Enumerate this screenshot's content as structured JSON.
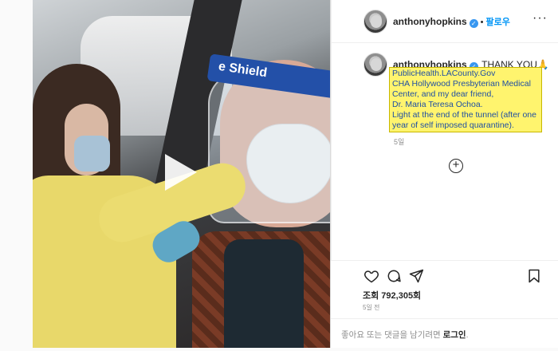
{
  "post": {
    "media": {
      "shield_text": "e Shield",
      "play_icon": "play-icon"
    },
    "header": {
      "username": "anthonyhopkins",
      "verified_icon": "verified-badge-icon",
      "separator": "•",
      "follow_label": "팔로우",
      "more_icon": "more-options-icon",
      "more_glyph": "···"
    },
    "caption": {
      "username": "anthonyhopkins",
      "title": "THANK YOU🙏",
      "lines": [
        "PublicHealth.LACounty.Gov",
        "CHA Hollywood Presbyterian Medical",
        "Center, and my dear friend,",
        "Dr. Maria Teresa Ochoa.",
        "Light at the end of the tunnel (after one",
        "year of self imposed quarantine)."
      ],
      "age": "5일"
    },
    "load_more_icon": "plus-circle-icon",
    "actions": {
      "like_icon": "heart-icon",
      "comment_icon": "comment-icon",
      "share_icon": "send-icon",
      "save_icon": "bookmark-icon",
      "views_label": "조회 792,305회",
      "time_ago": "5일 전"
    },
    "comment_bar": {
      "prompt": "좋아요 또는 댓글을 남기려면 ",
      "login_link": "로그인",
      "suffix": "."
    }
  },
  "colors": {
    "highlight": "#fff46e",
    "link_blue": "#1f4fa3",
    "follow_blue": "#0095f6",
    "shield_band": "#2350a8"
  }
}
